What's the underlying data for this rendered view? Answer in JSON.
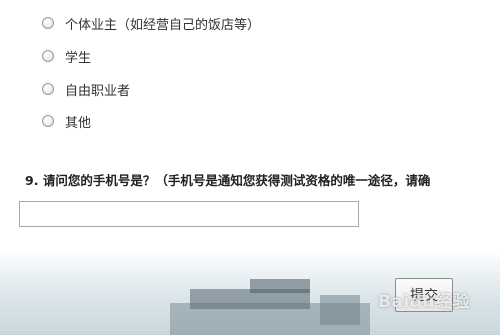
{
  "options": [
    {
      "label": "个体业主（如经营自己的饭店等）"
    },
    {
      "label": "学生"
    },
    {
      "label": "自由职业者"
    },
    {
      "label": "其他"
    }
  ],
  "question": {
    "number": "9.",
    "text": "请问您的手机号是？（手机号是通知您获得测试资格的唯一途径，请确"
  },
  "phone_input": {
    "value": ""
  },
  "submit": {
    "label": "提交"
  },
  "watermark": {
    "text": "Baidu经验"
  }
}
